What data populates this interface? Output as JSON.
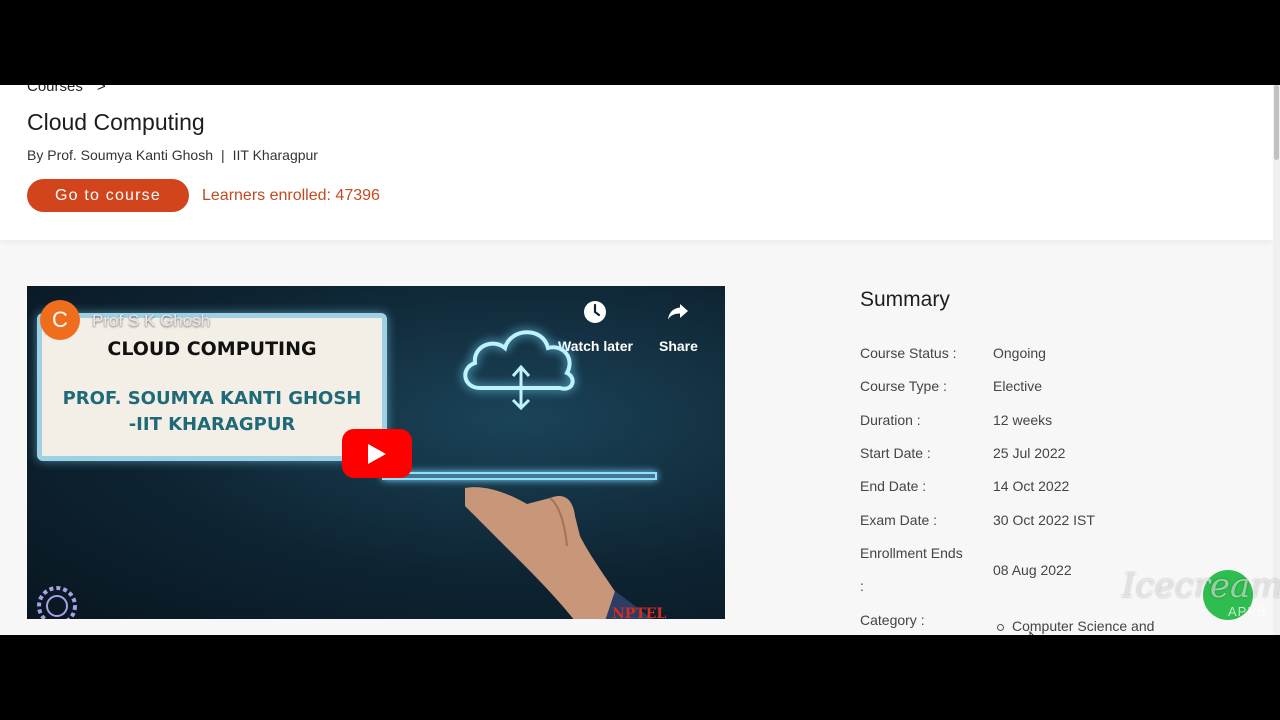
{
  "breadcrumb": {
    "courses": "Courses",
    "separator": ">"
  },
  "course": {
    "title": "Cloud Computing",
    "by": "By Prof. Soumya Kanti Ghosh",
    "separator": "|",
    "institute": "IIT Kharagpur",
    "go_button": "Go to course",
    "learners_enrolled": "Learners enrolled: 47396"
  },
  "video": {
    "channel_initial": "C",
    "channel_name": "Prof S K Ghosh",
    "watch_later": "Watch later",
    "share": "Share",
    "card_line1": "CLOUD COMPUTING",
    "card_line2": "PROF. SOUMYA KANTI GHOSH",
    "card_line3": "-IIT KHARAGPUR",
    "corner_text": "NPTEL",
    "icons": [
      "clock-icon",
      "share-arrow-icon",
      "play-icon",
      "cloud-icon"
    ]
  },
  "summary": {
    "title": "Summary",
    "rows": [
      {
        "label": "Course Status :",
        "value": "Ongoing"
      },
      {
        "label": "Course Type :",
        "value": "Elective"
      },
      {
        "label": "Duration :",
        "value": "12 weeks"
      },
      {
        "label": "Start Date :",
        "value": "25 Jul 2022"
      },
      {
        "label": "End Date :",
        "value": "14 Oct 2022"
      },
      {
        "label": "Exam Date :",
        "value": "30 Oct 2022 IST"
      },
      {
        "label": "Enrollment Ends",
        "label2": ":",
        "value": "08 Aug 2022"
      },
      {
        "label": "Category :",
        "value": ""
      }
    ],
    "category_item": "Computer Science and"
  },
  "watermark": {
    "text": "Icecream",
    "apps": "APPS"
  },
  "colors": {
    "accent": "#d2441b",
    "enrolled": "#c44a1e",
    "youtube_red": "#ff0000"
  }
}
